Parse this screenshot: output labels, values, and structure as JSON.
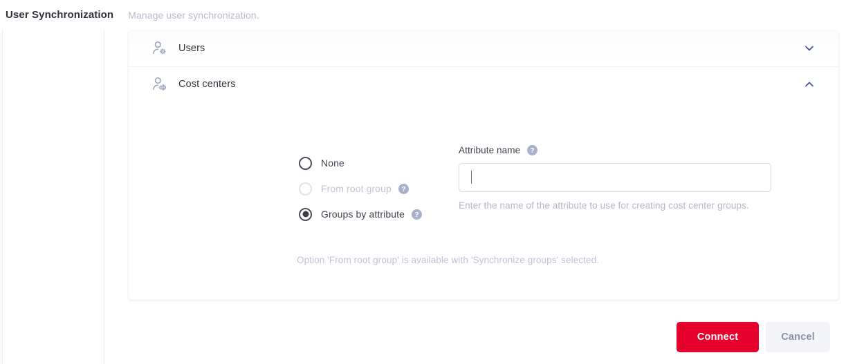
{
  "header": {
    "title": "User Synchronization",
    "subtitle": "Manage user synchronization."
  },
  "sections": [
    {
      "id": "users",
      "icon": "user-gear-icon",
      "label": "Users",
      "expanded": false,
      "chevron": "chevron-down-icon"
    },
    {
      "id": "cost-centers",
      "icon": "user-tag-icon",
      "label": "Cost centers",
      "expanded": true,
      "chevron": "chevron-up-icon"
    }
  ],
  "cost_centers": {
    "radios": [
      {
        "id": "none",
        "label": "None",
        "checked": false,
        "disabled": false,
        "help": false
      },
      {
        "id": "from-root-group",
        "label": "From root group",
        "checked": false,
        "disabled": true,
        "help": true
      },
      {
        "id": "groups-by-attribute",
        "label": "Groups by attribute",
        "checked": true,
        "disabled": false,
        "help": true
      }
    ],
    "attribute_field": {
      "label": "Attribute name",
      "value": "",
      "placeholder": "",
      "hint": "Enter the name of the attribute to use for creating cost center groups.",
      "help": true
    },
    "note": "Option 'From root group' is available with 'Synchronize groups' selected."
  },
  "footer": {
    "connect_label": "Connect",
    "cancel_label": "Cancel"
  },
  "colors": {
    "primary": "#e4002b",
    "secondary_bg": "#f2f4f9",
    "icon": "#9aa0bd",
    "muted_text": "#b8bbcc"
  }
}
